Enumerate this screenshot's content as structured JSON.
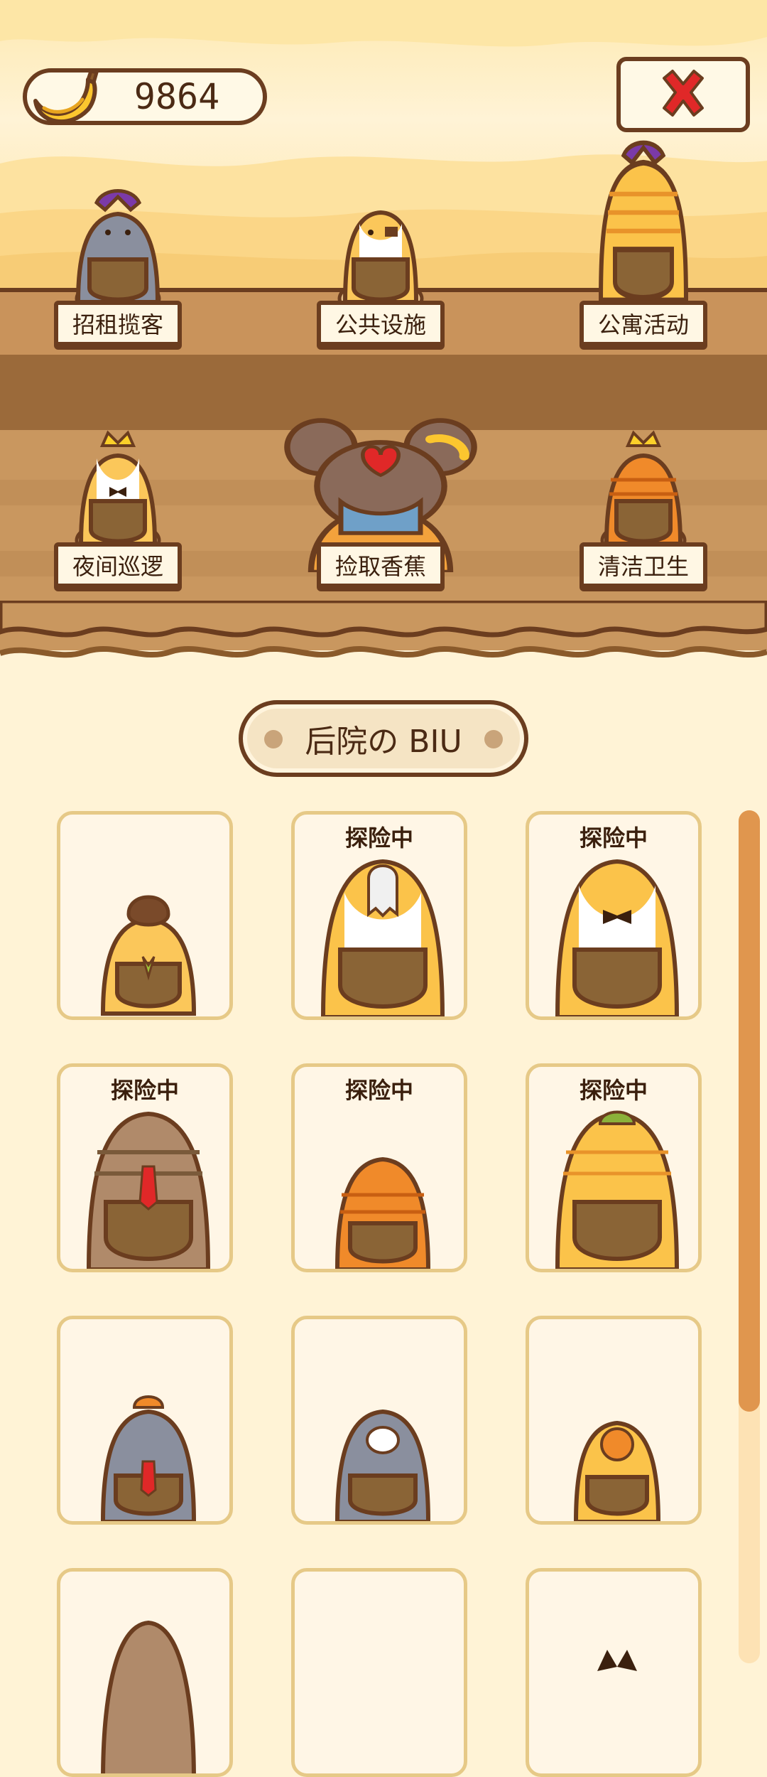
{
  "banana_count": "9864",
  "colors": {
    "outline": "#6b3d1f",
    "cream": "#fff6e6",
    "accent_red": "#e02828",
    "scroll_thumb": "#e0964e"
  },
  "icons": {
    "currency": "banana-icon",
    "close": "close-x-icon"
  },
  "shelf": {
    "stations": [
      {
        "label": "招租揽客",
        "cat": "gray-cat-jester-hat"
      },
      {
        "label": "公共设施",
        "cat": "calico-cat-eyepatch"
      },
      {
        "label": "公寓活动",
        "cat": "orange-tabby-jester"
      },
      {
        "label": "夜间巡逻",
        "cat": "white-crowned-cat"
      },
      {
        "label": "捡取香蕉",
        "cat": "brown-mouse-boss"
      },
      {
        "label": "清洁卫生",
        "cat": "orange-crowned-cat"
      }
    ]
  },
  "section": {
    "title": "后院の BIU"
  },
  "backyard": {
    "cells": [
      {
        "status": "",
        "cat": "cat-with-mushroom-hat"
      },
      {
        "status": "探险中",
        "cat": "cat-with-ghost-mask"
      },
      {
        "status": "探险中",
        "cat": "orange-white-bowtie-cat"
      },
      {
        "status": "探险中",
        "cat": "brown-tabby-red-tie-cat"
      },
      {
        "status": "探险中",
        "cat": "small-orange-tabby-cat"
      },
      {
        "status": "探险中",
        "cat": "orange-tabby-green-cap"
      },
      {
        "status": "",
        "cat": "gray-cat-orange-cap"
      },
      {
        "status": "",
        "cat": "gray-bunny-cat"
      },
      {
        "status": "",
        "cat": "orange-chick-cat"
      },
      {
        "status": "",
        "cat": "tabby-cat-partial"
      },
      {
        "status": "",
        "cat": "empty"
      },
      {
        "status": "",
        "cat": "black-ears-partial"
      }
    ]
  }
}
